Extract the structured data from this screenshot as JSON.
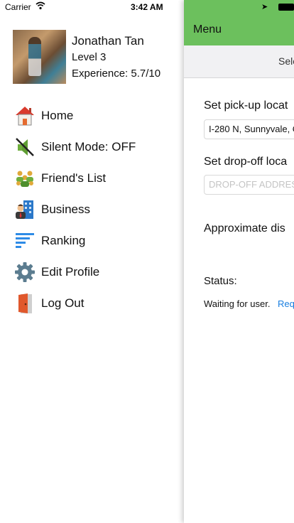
{
  "status_bar": {
    "carrier": "Carrier",
    "time": "3:42 AM"
  },
  "profile": {
    "name": "Jonathan Tan",
    "level": "Level 3",
    "experience": "Experience: 5.7/10"
  },
  "menu": {
    "items": [
      {
        "label": "Home",
        "icon": "home-icon"
      },
      {
        "label": "Silent Mode: OFF",
        "icon": "speaker-muted-icon"
      },
      {
        "label": "Friend's List",
        "icon": "friends-icon"
      },
      {
        "label": "Business",
        "icon": "business-icon"
      },
      {
        "label": "Ranking",
        "icon": "ranking-icon"
      },
      {
        "label": "Edit Profile",
        "icon": "gear-icon"
      },
      {
        "label": "Log Out",
        "icon": "door-icon"
      }
    ]
  },
  "main": {
    "nav_title": "Menu",
    "segment_text": "Sele",
    "pickup_label": "Set pick-up locat",
    "pickup_value": "I-280 N, Sunnyvale, C",
    "dropoff_label": "Set drop-off loca",
    "dropoff_placeholder": "DROP-OFF ADDRESS",
    "approx_label": "Approximate dis",
    "status_label": "Status:",
    "status_text": "Waiting for user.",
    "request_link": "Req"
  },
  "colors": {
    "nav_green": "#6cc05d",
    "link_blue": "#1a7fe0"
  }
}
